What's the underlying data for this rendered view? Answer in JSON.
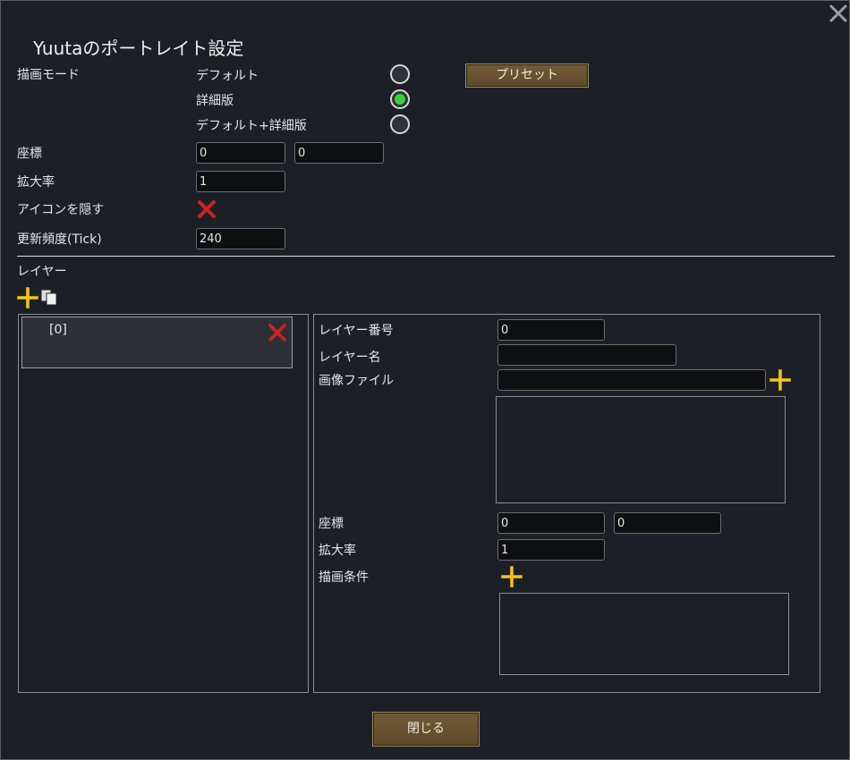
{
  "window": {
    "title": "Yuutaのポートレイト設定"
  },
  "draw_mode": {
    "label": "描画モード",
    "options": [
      {
        "label": "デフォルト",
        "selected": false
      },
      {
        "label": "詳細版",
        "selected": true
      },
      {
        "label": "デフォルト+詳細版",
        "selected": false
      }
    ],
    "preset_button": "プリセット"
  },
  "position": {
    "label": "座標",
    "x": "0",
    "y": "0"
  },
  "scale": {
    "label": "拡大率",
    "value": "1"
  },
  "hide_icon": {
    "label": "アイコンを隠す",
    "checked": false
  },
  "update_rate": {
    "label": "更新頻度(Tick)",
    "value": "240"
  },
  "layers": {
    "section_label": "レイヤー",
    "items": [
      {
        "label": "[0]"
      }
    ]
  },
  "layer_detail": {
    "number_label": "レイヤー番号",
    "number_value": "0",
    "name_label": "レイヤー名",
    "name_value": "",
    "image_label": "画像ファイル",
    "image_value": "",
    "position_label": "座標",
    "pos_x": "0",
    "pos_y": "0",
    "scale_label": "拡大率",
    "scale_value": "1",
    "condition_label": "描画条件"
  },
  "footer": {
    "close_button": "閉じる"
  },
  "colors": {
    "background": "#1c2026",
    "accent_add": "#f5c518",
    "remove": "#d42020",
    "radio_on": "#35d535",
    "button_wood": "#6b5330"
  },
  "icons": {
    "close": "close-icon",
    "add": "plus-icon",
    "copy": "copy-icon",
    "remove": "red-x-icon"
  }
}
